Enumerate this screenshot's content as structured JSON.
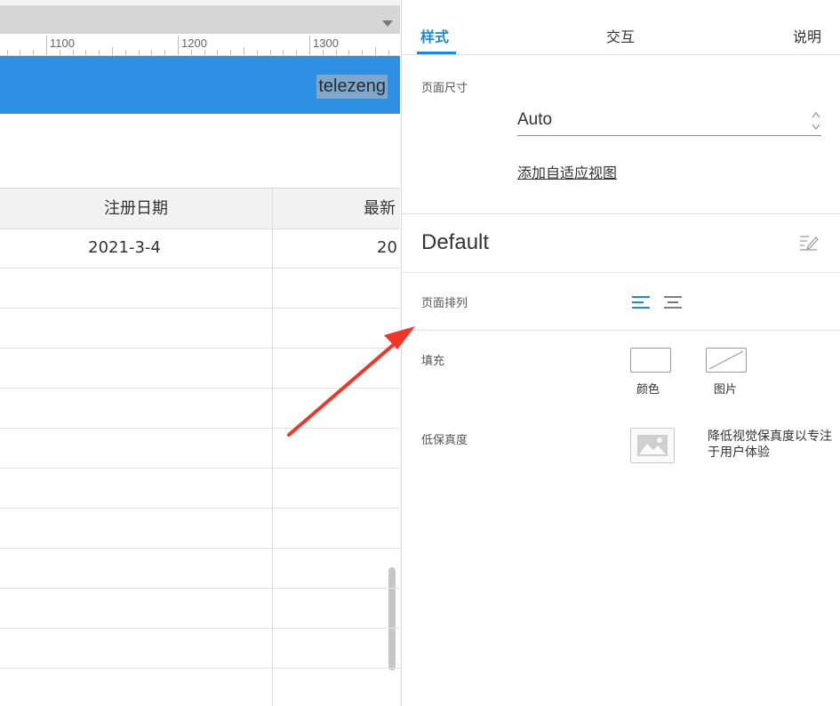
{
  "canvas": {
    "ruler_labels": [
      "1100",
      "1200",
      "1300"
    ],
    "header_username": "telezeng",
    "table": {
      "headers": [
        "注册日期",
        "最新"
      ],
      "rows": [
        [
          "2021-3-4",
          "20"
        ]
      ]
    }
  },
  "panel": {
    "tabs": [
      {
        "label": "样式",
        "active": true
      },
      {
        "label": "交互",
        "active": false
      },
      {
        "label": "说明",
        "active": false
      }
    ],
    "page_size": {
      "label": "页面尺寸",
      "value": "Auto",
      "adaptive_link": "添加自适应视图"
    },
    "style_name": "Default",
    "page_arrange": {
      "label": "页面排列",
      "options": [
        "align-left-icon",
        "align-center-icon"
      ],
      "selected": "align-left-icon"
    },
    "fill": {
      "label": "填充",
      "color_label": "颜色",
      "image_label": "图片"
    },
    "low_fidelity": {
      "label": "低保真度",
      "description": "降低视觉保真度以专注于用户体验"
    }
  },
  "colors": {
    "accent": "#1e88d6",
    "header_blue": "#2d90e2",
    "annotation_arrow": "#f0352a"
  }
}
